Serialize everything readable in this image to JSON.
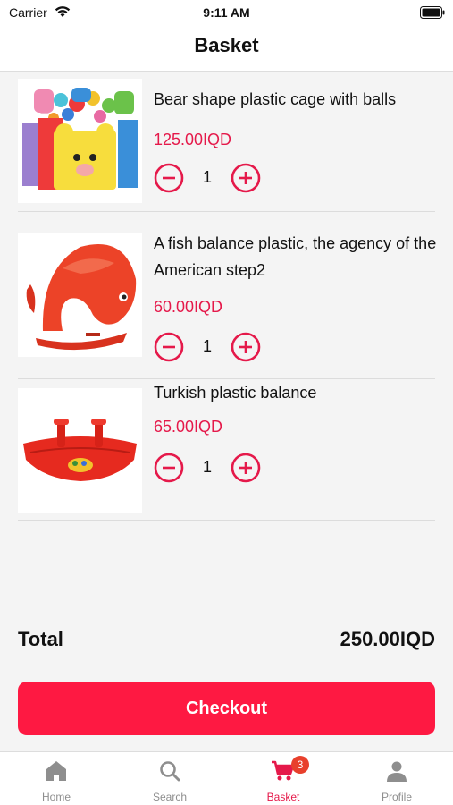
{
  "status_bar": {
    "carrier": "Carrier",
    "time": "9:11 AM"
  },
  "header": {
    "title": "Basket"
  },
  "items": [
    {
      "name": "Bear shape plastic cage with balls",
      "price": "125.00IQD",
      "quantity": "1",
      "image": "bear-ball-pit-image"
    },
    {
      "name": "A fish balance plastic, the agency of the American step2",
      "price": "60.00IQD",
      "quantity": "1",
      "image": "fish-rocker-image"
    },
    {
      "name": "Turkish plastic balance",
      "price": "65.00IQD",
      "quantity": "1",
      "image": "seesaw-image"
    }
  ],
  "summary": {
    "total_label": "Total",
    "total_value": "250.00IQD"
  },
  "checkout": {
    "label": "Checkout"
  },
  "tabs": [
    {
      "label": "Home",
      "icon": "home-icon"
    },
    {
      "label": "Search",
      "icon": "search-icon"
    },
    {
      "label": "Basket",
      "icon": "cart-icon",
      "badge": "3",
      "active": true
    },
    {
      "label": "Profile",
      "icon": "person-icon"
    }
  ],
  "colors": {
    "accent": "#fe1942",
    "price": "#e5194a",
    "background": "#f4f4f4"
  }
}
